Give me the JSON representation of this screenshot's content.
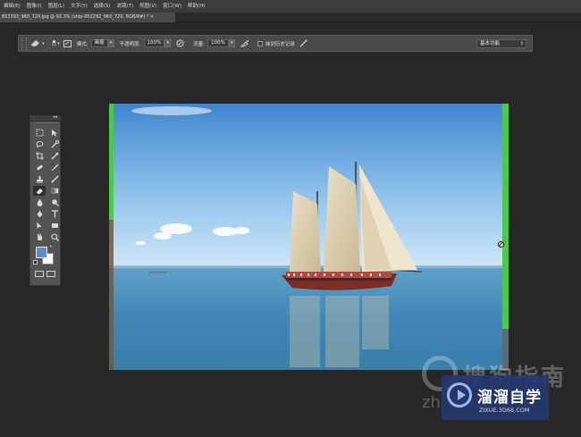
{
  "menubar": {
    "items": [
      "编辑(E)",
      "图像(I)",
      "图层(L)",
      "文字(Y)",
      "选择(S)",
      "滤镜(T)",
      "视图(V)",
      "窗口(W)",
      "帮助(H)"
    ]
  },
  "document_tab": {
    "title": "853393_960_720.jpg @ 92.3% (ship-952292_960_720, RGB/8#) * ×"
  },
  "options_bar": {
    "brush_size": "11",
    "mode_label": "模式:",
    "mode_value": "画笔",
    "opacity_label": "不透明度:",
    "opacity_value": "100%",
    "flow_label": "流量:",
    "flow_value": "100%",
    "history_label": "抹到历史记录",
    "workspace_value": "基本功能",
    "icons": [
      "eraser-tool-icon",
      "brush-preset-icon",
      "brush-panel-icon",
      "pressure-opacity-icon",
      "airbrush-icon",
      "pressure-size-icon"
    ]
  },
  "tools_panel": {
    "collapse_glyph": "◂◂",
    "tools": [
      "rect-marquee-icon",
      "move-icon",
      "lasso-icon",
      "quick-select-icon",
      "crop-icon",
      "eyedropper-icon",
      "spot-heal-icon",
      "brush-icon",
      "clone-stamp-icon",
      "history-brush-icon",
      "eraser-icon",
      "gradient-icon",
      "blur-icon",
      "dodge-icon",
      "pen-icon",
      "type-icon",
      "path-select-icon",
      "rect-shape-icon",
      "hand-icon",
      "zoom-icon"
    ],
    "selected_tool": "eraser-icon",
    "foreground_color": "#5d8bcf",
    "background_color": "#ffffff"
  },
  "canvas": {
    "image_subject": "sailing-ship-photo",
    "side_bar_color": "#4cc94c"
  },
  "watermarks": {
    "sogou_text": "搜狗指南",
    "sogou_url": "zh",
    "zixue_title": "溜溜自学",
    "zixue_url": "ZIXUE.3D66.COM"
  }
}
